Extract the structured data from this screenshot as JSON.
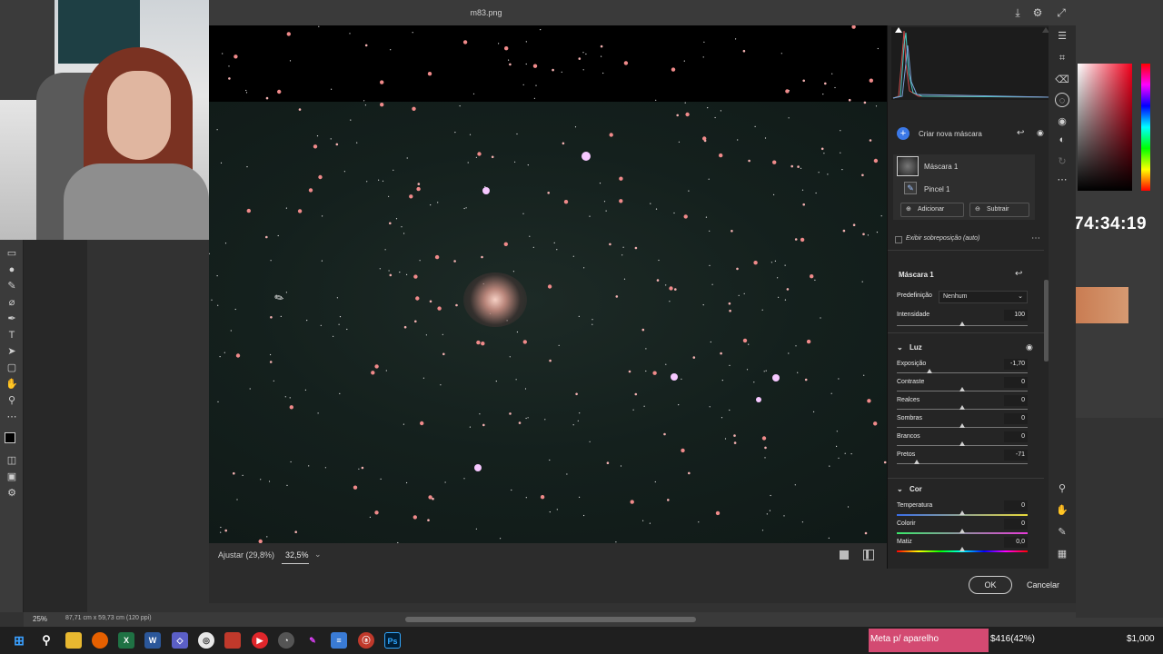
{
  "dialog": {
    "title": "m83.png",
    "zoom_fit": "Ajustar (29,8%)",
    "zoom_value": "32,5%",
    "ok": "OK",
    "cancel": "Cancelar"
  },
  "mask_panel": {
    "new_mask": "Criar nova máscara",
    "mask_name": "Máscara 1",
    "brush_name": "Pincel 1",
    "add": "Adicionar",
    "subtract": "Subtrair",
    "overlay_label": "Exibir sobreposição (auto)",
    "section_title": "Máscara 1",
    "preset_label": "Predefinição",
    "preset_value": "Nenhum",
    "intensity_label": "Intensidade",
    "intensity_value": "100"
  },
  "light": {
    "title": "Luz",
    "sliders": [
      {
        "label": "Exposição",
        "value": "-1,70",
        "pos": 0.25
      },
      {
        "label": "Contraste",
        "value": "0",
        "pos": 0.5
      },
      {
        "label": "Realces",
        "value": "0",
        "pos": 0.5
      },
      {
        "label": "Sombras",
        "value": "0",
        "pos": 0.5
      },
      {
        "label": "Brancos",
        "value": "0",
        "pos": 0.5
      },
      {
        "label": "Pretos",
        "value": "-71",
        "pos": 0.15
      }
    ]
  },
  "color": {
    "title": "Cor",
    "sliders": [
      {
        "label": "Temperatura",
        "value": "0",
        "pos": 0.5
      },
      {
        "label": "Colorir",
        "value": "0",
        "pos": 0.5
      },
      {
        "label": "Matiz",
        "value": "0,0",
        "pos": 0.5
      }
    ]
  },
  "ps": {
    "status_zoom": "25%",
    "status_dims": "87,71 cm x 59,73 cm (120 ppi)",
    "timer": "74:34:19"
  },
  "taskbar": {
    "goal_label": "Meta p/ aparelho",
    "goal_amount": "$416(42%)",
    "goal_total": "$1,000"
  }
}
